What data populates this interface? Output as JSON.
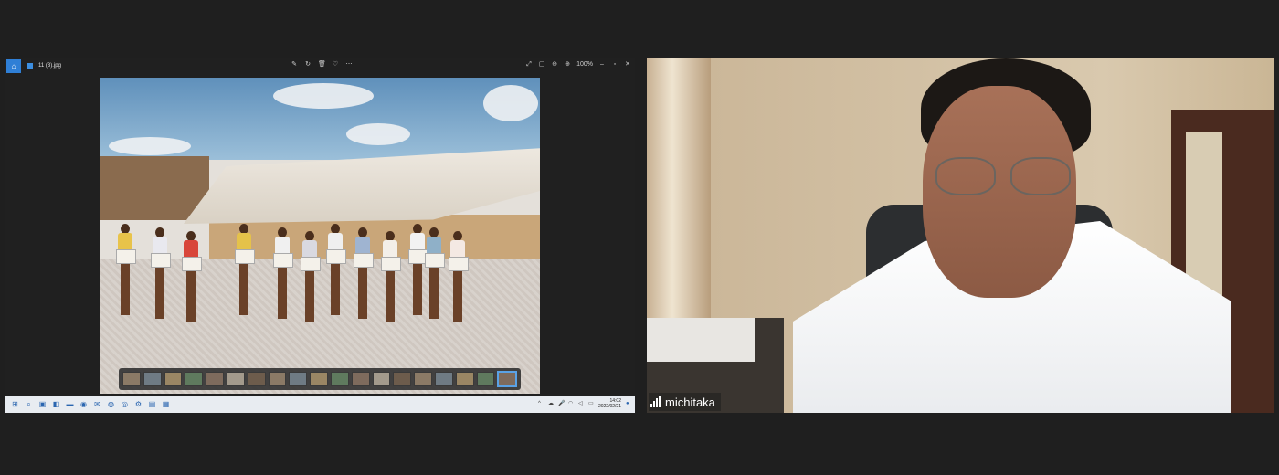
{
  "share_screen": {
    "file_name": "11 (3).jpg",
    "zoom_level": "100%",
    "toolbar_icons": [
      "edit-icon",
      "rotate-icon",
      "delete-icon",
      "favorite-icon",
      "more-icon"
    ],
    "window_controls": [
      "minimize-icon",
      "maximize-icon",
      "close-icon"
    ],
    "filmstrip_count": 19,
    "filmstrip_active_index": 18,
    "taskbar": {
      "clock_time": "14:02",
      "clock_date": "2022/02/21"
    }
  },
  "participant": {
    "name": "michitaka"
  }
}
